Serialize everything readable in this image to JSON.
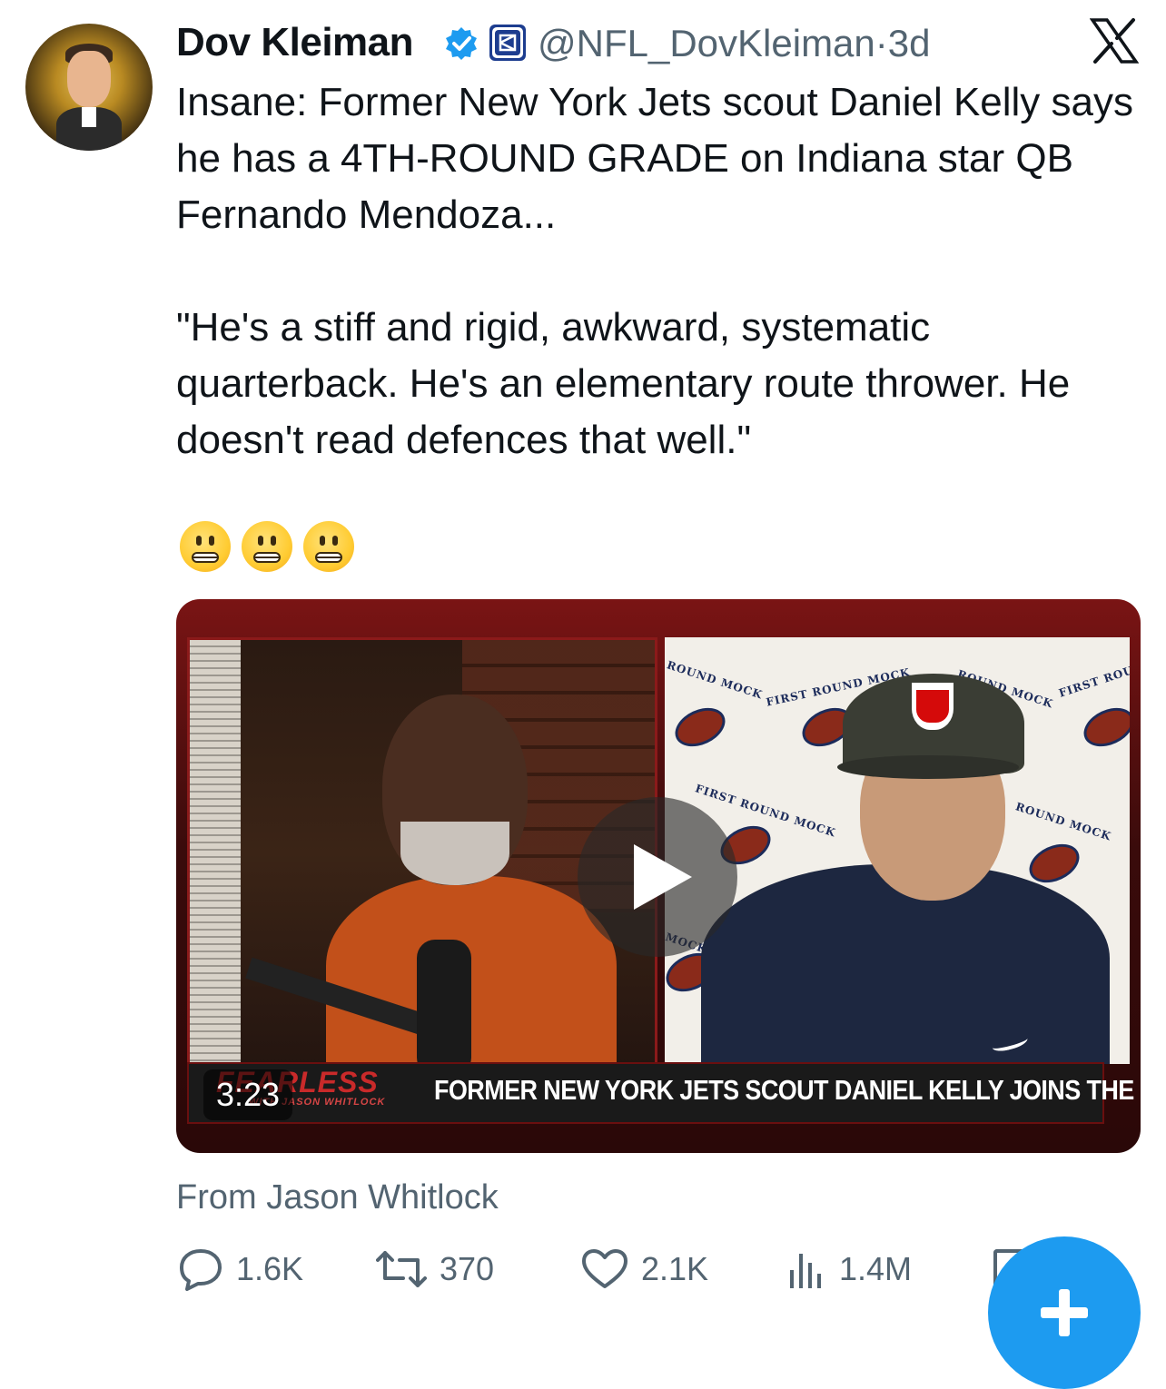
{
  "post": {
    "author_name": "Dov Kleiman",
    "handle": "@NFL_DovKleiman",
    "separator": "·",
    "time_ago": "3d",
    "verified_icon": "verified-badge-icon",
    "affiliate_icon": "affiliate-badge-icon",
    "platform_icon": "x-logo-icon",
    "text": "Insane: Former New York Jets scout Daniel Kelly says he has a 4TH-ROUND GRADE on Indiana star QB Fernando Mendoza...\n\n\"He's a stiff and rigid, awkward, systematic quarterback. He's an elementary route thrower. He doesn't read defences that well.\"",
    "emojis": [
      "grimacing-face",
      "grimacing-face",
      "grimacing-face"
    ]
  },
  "media": {
    "type": "video",
    "duration": "3:23",
    "chyron": "FORMER NEW YORK JETS SCOUT DANIEL KELLY JOINS THE SHOW",
    "show_logo": "FEARLESS",
    "show_subtitle": "WITH JASON WHITLOCK",
    "backdrop_text": [
      "FIRST ROUND MOCK",
      "ROUND MOCK",
      "FIRST ROUND MOCK",
      "ROUND MOCK",
      "ROUND MOCK",
      "FIRST ROUN",
      "MOCK"
    ],
    "hat_logo": "NFL"
  },
  "source_label": "From Jason Whitlock",
  "actions": {
    "replies": "1.6K",
    "reposts": "370",
    "likes": "2.1K",
    "views": "1.4M"
  },
  "colors": {
    "accent": "#1d9bf0",
    "muted_text": "#536471",
    "primary_text": "#0f1419"
  }
}
